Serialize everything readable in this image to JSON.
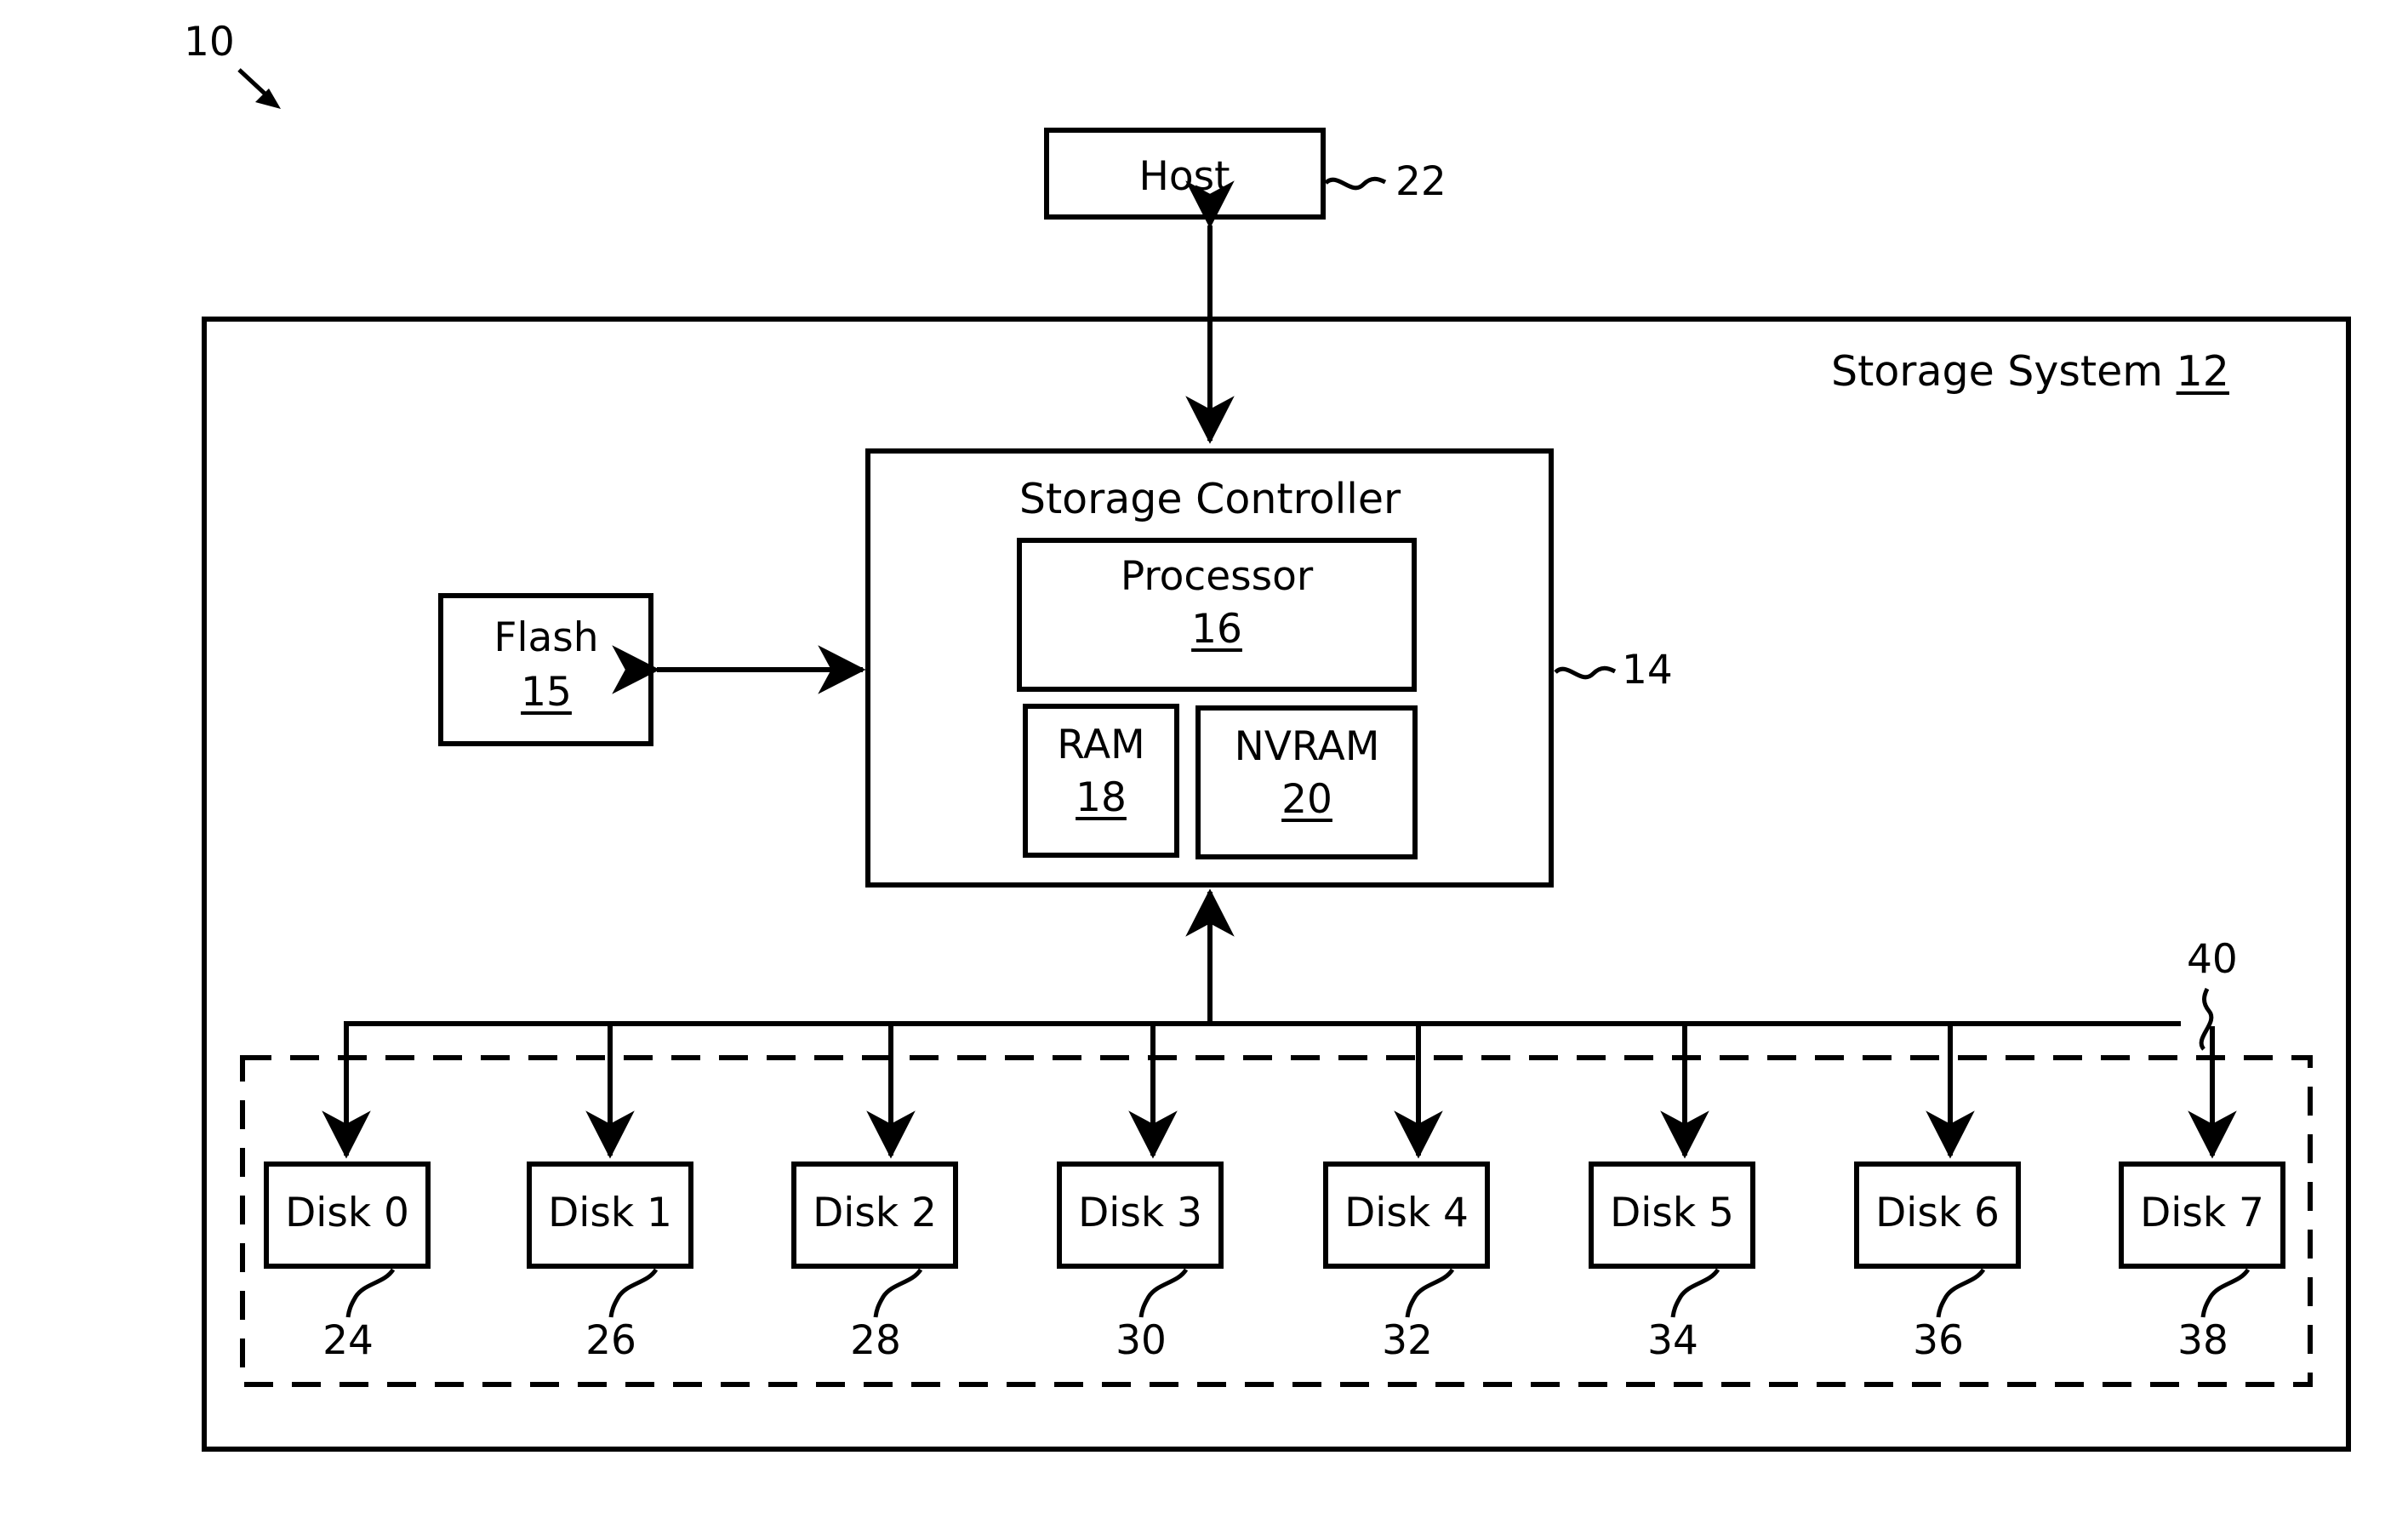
{
  "figure": {
    "figure_ref": "10",
    "system": {
      "label": "Storage System",
      "ref": "12"
    },
    "host": {
      "label": "Host",
      "ref": "22"
    },
    "controller": {
      "label": "Storage Controller",
      "ref": "14",
      "processor": {
        "label": "Processor",
        "ref": "16"
      },
      "ram": {
        "label": "RAM",
        "ref": "18"
      },
      "nvram": {
        "label": "NVRAM",
        "ref": "20"
      }
    },
    "flash": {
      "label": "Flash",
      "ref": "15"
    },
    "disk_array": {
      "ref": "40",
      "disks": [
        {
          "label": "Disk 0",
          "ref": "24"
        },
        {
          "label": "Disk 1",
          "ref": "26"
        },
        {
          "label": "Disk 2",
          "ref": "28"
        },
        {
          "label": "Disk 3",
          "ref": "30"
        },
        {
          "label": "Disk 4",
          "ref": "32"
        },
        {
          "label": "Disk 5",
          "ref": "34"
        },
        {
          "label": "Disk 6",
          "ref": "36"
        },
        {
          "label": "Disk 7",
          "ref": "38"
        }
      ]
    },
    "colors": {
      "stroke": "#000000",
      "background": "#ffffff"
    }
  }
}
